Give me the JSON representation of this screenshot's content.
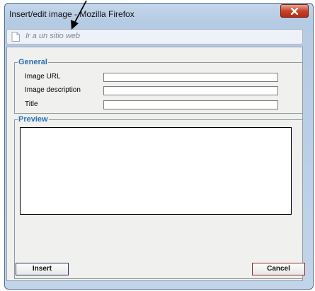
{
  "window": {
    "title": "Insert/edit image - Mozilla Firefox"
  },
  "urlbar": {
    "placeholder": "Ir a un sitio web"
  },
  "general": {
    "legend": "General",
    "fields": [
      {
        "label": "Image URL",
        "value": ""
      },
      {
        "label": "Image description",
        "value": ""
      },
      {
        "label": "Title",
        "value": ""
      }
    ]
  },
  "preview": {
    "legend": "Preview"
  },
  "buttons": {
    "insert": "Insert",
    "cancel": "Cancel"
  },
  "icons": {
    "close": "close-icon",
    "page": "page-icon",
    "arrow": "arrow-annotation"
  },
  "colors": {
    "legend": "#2b6fb6",
    "close_button": "#c7432a",
    "insert_border": "#1c2f63",
    "cancel_border": "#952828"
  }
}
